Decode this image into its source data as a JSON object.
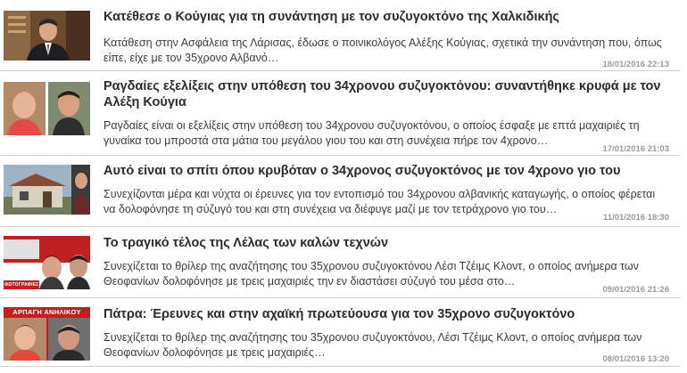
{
  "articles": [
    {
      "title": "Κατέθεσε ο Κούγιας για τη συνάντηση με τον συζυγοκτόνο της Χαλκιδικής",
      "excerpt": "Κατάθεση στην Ασφάλεια της Λάρισας, έδωσε ο ποινικολόγος Αλέξης Κούγιας, σχετικά την συνάντηση που, όπως είπε, είχε με τον 35χρονο Αλβανό…",
      "date": "18/01/2016 22:13"
    },
    {
      "title": "Ραγδαίες εξελίξεις στην υπόθεση του 34χρονου συζυγοκτόνου: συναντήθηκε κρυφά με τον Αλέξη Κούγια",
      "excerpt": "Ραγδαίες είναι οι εξελίξεις στην υπόθεση του 34χρονου συζυγοκτόνου, ο οποίος έσφαξε με επτά μαχαιριές τη γυναίκα του μπροστά στα μάτια του μεγάλου γιου του και στη συνέχεια πήρε τον 4χρονο…",
      "date": "17/01/2016 21:03"
    },
    {
      "title": "Αυτό είναι το σπίτι όπου κρυβόταν ο 34χρονος συζυγοκτόνος με τον 4χρονο γιο του",
      "excerpt": "Συνεχίζονται μέρα και νύχτα οι έρευνες για τον εντοπισμό του 34χρονου αλβανικής καταγωγής, ο οποίος φέρεται να δολοφόνησε τη σύζυγό του και στη συνέχεια να διέφυγε μαζί με τον τετράχρονο γιο του…",
      "date": "11/01/2016 18:30"
    },
    {
      "title": "Το τραγικό τέλος της Λέλας των καλών τεχνών",
      "excerpt": "Συνεχίζεται το θρίλερ της αναζήτησης του 35χρονου συζυγοκτόνου Λέσι Τζέιμς Κλοντ, ο οποίος ανήμερα των Θεοφανίων δολοφόνησε με τρεις μαχαιριές την εν διαστάσει σύζυγό του μέσα στο…",
      "date": "09/01/2016 21:26",
      "thumb_caption": "ΦΩΤΟΓΡΑΦΙΕΣ"
    },
    {
      "title": "Πάτρα: Έρευνες και στην αχαϊκή πρωτεύουσα για τον 35χρονο συζυγοκτόνο",
      "excerpt": "Συνεχίζεται το θρίλερ της αναζήτησης του 35χρονου συζυγοκτόνου, Λέσι Τζέιμς Κλοντ, ο οποίος ανήμερα των Θεοφανίων δολοφόνησε με τρεις μαχαιριές…",
      "date": "08/01/2016 13:20",
      "thumb_caption": "ΑΡΠΑΓΗ ΑΝΗΛΙΚΟΥ"
    }
  ],
  "colors": {
    "title": "#2b2b2b",
    "excerpt": "#3c3c3c",
    "date": "#9a9a9a",
    "divider": "#cfcfcf",
    "banner_red": "#c0201f"
  }
}
